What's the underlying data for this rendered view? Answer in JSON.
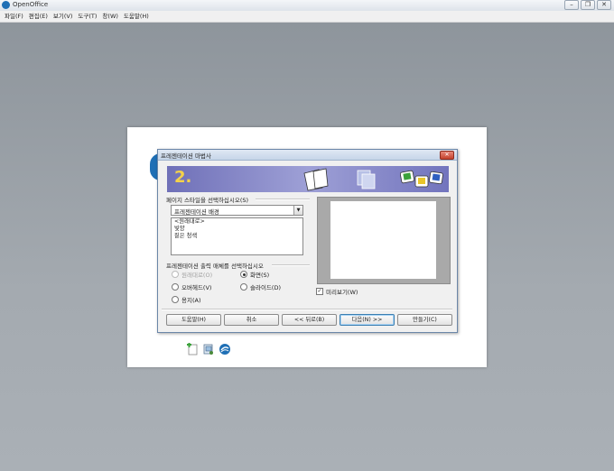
{
  "window": {
    "title": "OpenOffice"
  },
  "menu": [
    "파일(F)",
    "편집(E)",
    "보기(V)",
    "도구(T)",
    "창(W)",
    "도움말(H)"
  ],
  "dialog": {
    "title": "프레젠테이션 마법사",
    "step": "2.",
    "page_style_label": "페이지 스타일을 선택하십시오(S)",
    "page_style_selected": "프레젠테이션 배경",
    "page_style_list": [
      "<원래대로>",
      "빛양",
      "짙은 청색"
    ],
    "output_label": "프레젠테이션 출력 매체를 선택하십시오",
    "output_options": {
      "original": "원래대로(O)",
      "screen": "화면(S)",
      "overhead": "오버헤드(V)",
      "slide": "슬라이드(D)",
      "paper": "용지(A)"
    },
    "preview_label": "미리보기(W)",
    "buttons": {
      "help": "도움말(H)",
      "cancel": "취소",
      "back": "<< 뒤로(B)",
      "next": "다음(N) >>",
      "create": "만들기(C)"
    }
  },
  "colors": {
    "banner": "#7f81c7",
    "step_number": "#f4d24a",
    "accent": "#1f6fb5"
  },
  "icons": [
    "openoffice-logo-icon",
    "new-document-icon",
    "templates-icon",
    "openoffice-app-icon"
  ]
}
